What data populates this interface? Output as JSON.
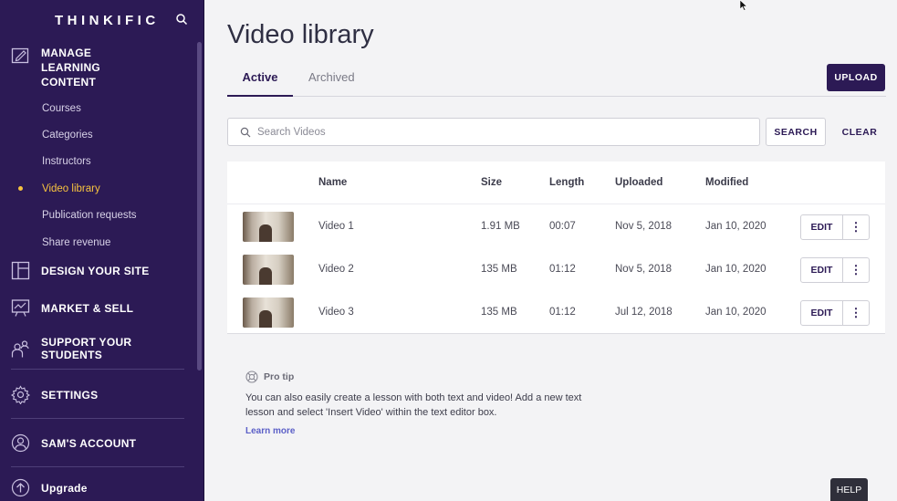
{
  "brand": {
    "logo_text": "THINKIFIC",
    "sidebar_bg": "#2c1a55",
    "accent_active": "#f7c33f"
  },
  "sidebar": {
    "sections": [
      {
        "label": "MANAGE LEARNING CONTENT",
        "icon": "edit-board-icon",
        "items": [
          {
            "label": "Courses",
            "active": false
          },
          {
            "label": "Categories",
            "active": false
          },
          {
            "label": "Instructors",
            "active": false
          },
          {
            "label": "Video library",
            "active": true
          },
          {
            "label": "Publication requests",
            "active": false
          },
          {
            "label": "Share revenue",
            "active": false
          }
        ]
      },
      {
        "label": "DESIGN YOUR SITE",
        "icon": "layout-icon"
      },
      {
        "label": "MARKET & SELL",
        "icon": "presentation-chart-icon"
      },
      {
        "label": "SUPPORT YOUR STUDENTS",
        "icon": "people-icon"
      },
      {
        "label": "SETTINGS",
        "icon": "gear-icon"
      },
      {
        "label": "SAM'S ACCOUNT",
        "icon": "user-circle-icon"
      },
      {
        "label": "Upgrade",
        "icon": "upgrade-arrow-icon"
      }
    ]
  },
  "main": {
    "title": "Video library",
    "tabs": [
      {
        "label": "Active",
        "active": true
      },
      {
        "label": "Archived",
        "active": false
      }
    ],
    "upload_label": "UPLOAD",
    "search": {
      "placeholder": "Search Videos",
      "value": "",
      "search_label": "SEARCH",
      "clear_label": "CLEAR"
    },
    "table": {
      "columns": [
        "Name",
        "Size",
        "Length",
        "Uploaded",
        "Modified"
      ],
      "rows": [
        {
          "name": "Video 1",
          "size": "1.91 MB",
          "length": "00:07",
          "uploaded": "Nov 5, 2018",
          "modified": "Jan 10, 2020"
        },
        {
          "name": "Video 2",
          "size": "135 MB",
          "length": "01:12",
          "uploaded": "Nov 5, 2018",
          "modified": "Jan 10, 2020"
        },
        {
          "name": "Video 3",
          "size": "135 MB",
          "length": "01:12",
          "uploaded": "Jul 12, 2018",
          "modified": "Jan 10, 2020"
        }
      ],
      "edit_label": "EDIT",
      "more_label": "⋮"
    },
    "protip": {
      "heading": "Pro tip",
      "text": "You can also easily create a lesson with both text and video! Add a new text lesson and select 'Insert Video' within the text editor box.",
      "link": "Learn more"
    },
    "help_label": "HELP"
  }
}
